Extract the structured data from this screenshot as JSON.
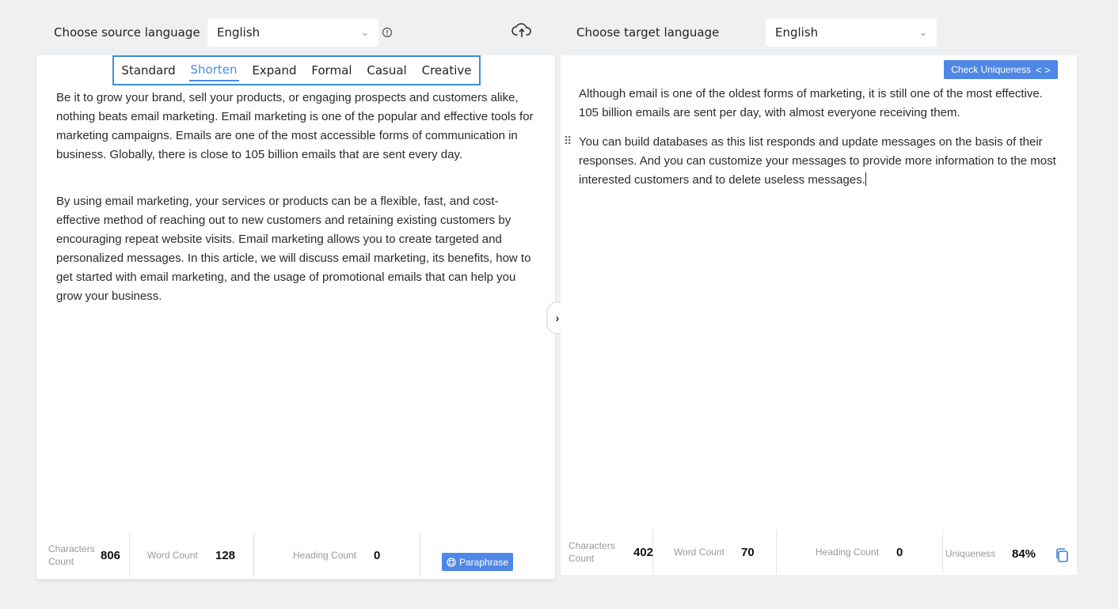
{
  "source": {
    "label": "Choose source language",
    "selected": "English"
  },
  "target": {
    "label": "Choose target language",
    "selected": "English"
  },
  "modes": [
    "Standard",
    "Shorten",
    "Expand",
    "Formal",
    "Casual",
    "Creative"
  ],
  "active_mode": "Shorten",
  "input_text": {
    "p1": "Be it to grow your brand, sell your products, or engaging prospects and customers alike, nothing beats email marketing. Email marketing is one of the popular and effective tools for marketing campaigns. Emails are one of the most accessible forms of communication in business. Globally, there is close to 105 billion emails that are sent every day.",
    "p2": "By using email marketing, your services or products can be a flexible, fast, and cost-effective method of reaching out to new customers and retaining existing customers by encouraging repeat website visits. Email marketing allows you to create targeted and personalized messages. In this article, we will discuss email marketing, its benefits, how to get started with email marketing, and the usage of promotional emails that can help you grow your business."
  },
  "output_text": {
    "p1": "Although email is one of the oldest forms of marketing, it is still one of the most effective. 105 billion emails are sent per day, with almost everyone receiving them.",
    "p2": "You can build databases as this list responds and update messages on the basis of their responses. And you can customize your messages to provide more information to the most interested customers and to delete useless messages."
  },
  "left_stats": {
    "chars_label": "Characters Count",
    "chars": "806",
    "words_label": "Word Count",
    "words": "128",
    "headings_label": "Heading Count",
    "headings": "0"
  },
  "right_stats": {
    "chars_label": "Characters Count",
    "chars": "402",
    "words_label": "Word Count",
    "words": "70",
    "headings_label": "Heading Count",
    "headings": "0",
    "uniqueness_label": "Uniqueness",
    "uniqueness": "84%"
  },
  "buttons": {
    "paraphrase": "Paraphrase",
    "check_uniqueness": "Check Uniqueness"
  },
  "icons": {
    "info": "info-icon",
    "upload": "cloud-upload-icon",
    "copy": "copy-icon",
    "toggle": "chevron-right-icon",
    "drag": "drag-handle-icon"
  },
  "colors": {
    "accent": "#4f87e6",
    "mode_border": "#3b8ed8",
    "background": "#eef0f2"
  }
}
